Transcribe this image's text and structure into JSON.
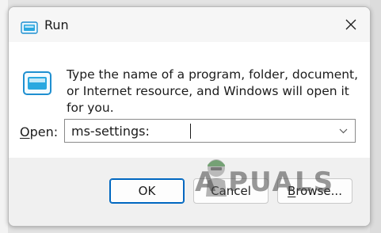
{
  "window": {
    "title": "Run",
    "description": "Type the name of a program, folder, document, or Internet resource, and Windows will open it for you.",
    "open_label_accel": "O",
    "open_label_rest": "pen:",
    "command_value": "ms-settings:"
  },
  "buttons": {
    "ok": "OK",
    "cancel": "Cancel",
    "browse_accel": "B",
    "browse_rest": "rowse..."
  },
  "watermark": {
    "text": "A  PUALS"
  },
  "icons": {
    "title": "run-icon",
    "content": "run-icon",
    "close": "close-icon",
    "dropdown": "chevron-down-icon"
  },
  "colors": {
    "accent": "#0067c0",
    "icon_fill": "#2aa8e0"
  }
}
